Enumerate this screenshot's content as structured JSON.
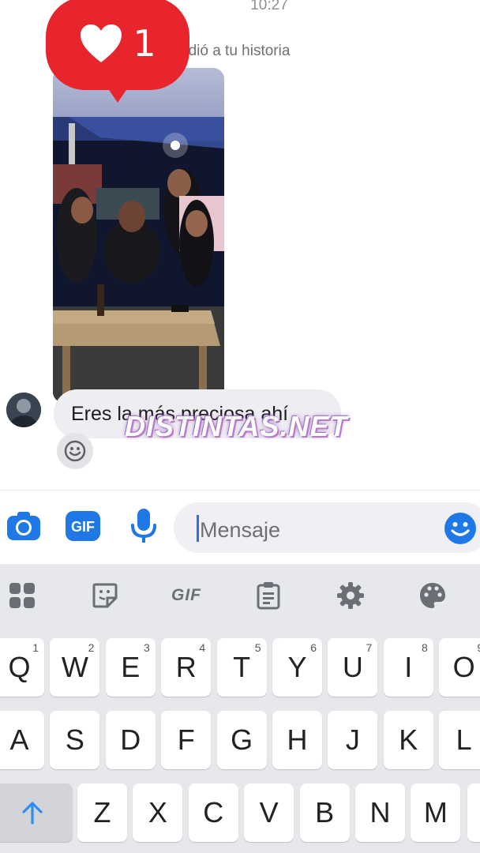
{
  "chat": {
    "time": "10:27",
    "story_reply_text": "ndió a tu historia",
    "reaction_count": "1",
    "message": "Eres la más preciosa ahí",
    "watermark": "DISTINTAS.NET"
  },
  "composer": {
    "placeholder": "Mensaje",
    "gif_label": "GIF"
  },
  "keyboard": {
    "toolbar_gif": "GIF",
    "row1": [
      {
        "k": "Q",
        "h": "1"
      },
      {
        "k": "W",
        "h": "2"
      },
      {
        "k": "E",
        "h": "3"
      },
      {
        "k": "R",
        "h": "4"
      },
      {
        "k": "T",
        "h": "5"
      },
      {
        "k": "Y",
        "h": "6"
      },
      {
        "k": "U",
        "h": "7"
      },
      {
        "k": "I",
        "h": "8"
      },
      {
        "k": "O",
        "h": "9"
      }
    ],
    "row2": [
      "A",
      "S",
      "D",
      "F",
      "G",
      "H",
      "J",
      "K",
      "L"
    ],
    "row3": [
      "Z",
      "X",
      "C",
      "V",
      "B",
      "N",
      "M"
    ]
  },
  "colors": {
    "reaction_red": "#e8242c",
    "accent_blue": "#1f78e6",
    "keyboard_bg": "#e7e8ec"
  }
}
